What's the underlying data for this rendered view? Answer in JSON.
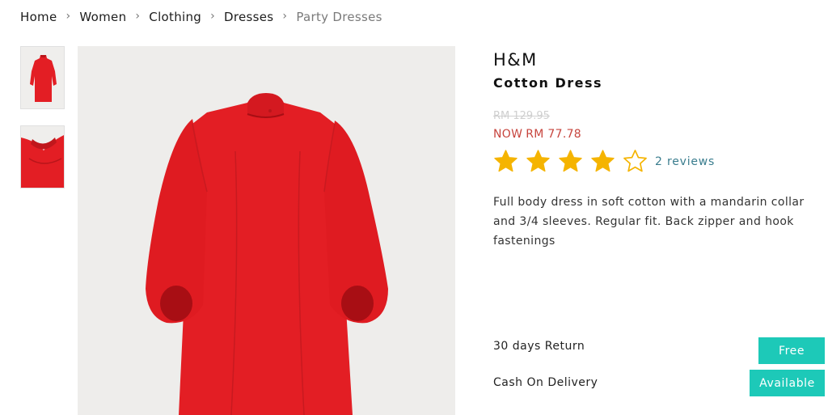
{
  "breadcrumb": {
    "items": [
      "Home",
      "Women",
      "Clothing",
      "Dresses",
      "Party Dresses"
    ]
  },
  "product": {
    "brand": "H&M",
    "title": "Cotton Dress",
    "old_price": "RM 129.95",
    "now_label": "NOW",
    "now_price": "RM 77.78",
    "rating": 4,
    "rating_max": 5,
    "reviews_label": "2 reviews",
    "description": "Full body dress in soft cotton with a mandarin collar and 3/4 sleeves. Regular fit. Back zipper and hook fastenings"
  },
  "shipping": {
    "return_label": "30 days Return",
    "return_badge": "Free",
    "cod_label": "Cash On Delivery",
    "cod_badge": "Available"
  },
  "colors": {
    "accent_teal": "#1dc9b8",
    "price_red": "#c7453e",
    "star_gold": "#f5b400",
    "dress_red": "#e31e24"
  },
  "icons": {
    "separator": "chevron-right-icon",
    "star_filled": "star-filled-icon",
    "star_empty": "star-outline-icon"
  }
}
